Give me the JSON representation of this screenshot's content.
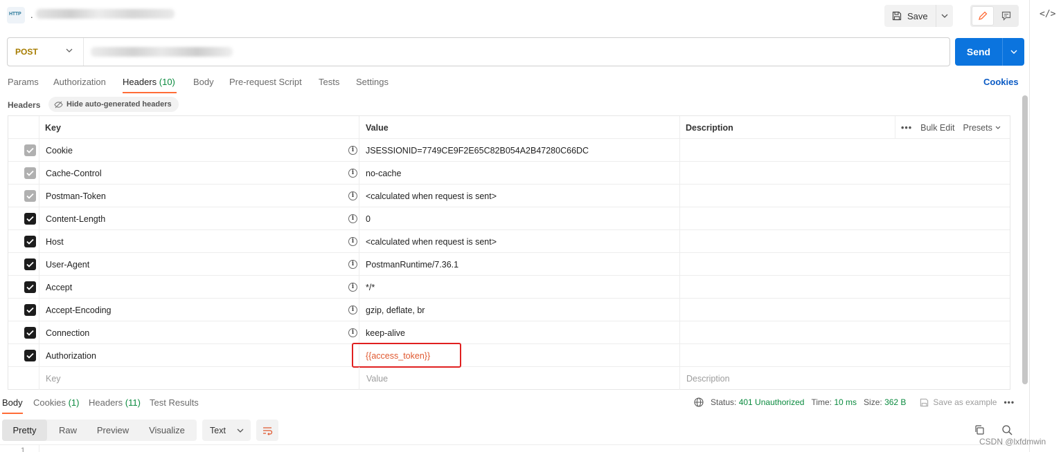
{
  "top": {
    "method_icon_label": "HTTP",
    "tab_prefix": ".",
    "save_label": "Save"
  },
  "url": {
    "method": "POST",
    "send_label": "Send"
  },
  "request_tabs": [
    {
      "label": "Params",
      "count": ""
    },
    {
      "label": "Authorization",
      "count": ""
    },
    {
      "label": "Headers",
      "count": "(10)"
    },
    {
      "label": "Body",
      "count": ""
    },
    {
      "label": "Pre-request Script",
      "count": ""
    },
    {
      "label": "Tests",
      "count": ""
    },
    {
      "label": "Settings",
      "count": ""
    }
  ],
  "cookies_label": "Cookies",
  "headers_section": {
    "title": "Headers",
    "hide_auto_label": "Hide auto-generated headers"
  },
  "table": {
    "columns": {
      "key": "Key",
      "value": "Value",
      "description": "Description"
    },
    "bulk_edit": "Bulk Edit",
    "presets": "Presets",
    "rows": [
      {
        "key": "Cookie",
        "value": "JSESSIONID=7749CE9F2E65C82B054A2B47280C66DC",
        "enabled": "auto"
      },
      {
        "key": "Cache-Control",
        "value": "no-cache",
        "enabled": "auto"
      },
      {
        "key": "Postman-Token",
        "value": "<calculated when request is sent>",
        "enabled": "auto"
      },
      {
        "key": "Content-Length",
        "value": "0",
        "enabled": "on"
      },
      {
        "key": "Host",
        "value": "<calculated when request is sent>",
        "enabled": "on"
      },
      {
        "key": "User-Agent",
        "value": "PostmanRuntime/7.36.1",
        "enabled": "on"
      },
      {
        "key": "Accept",
        "value": "*/*",
        "enabled": "on"
      },
      {
        "key": "Accept-Encoding",
        "value": "gzip, deflate, br",
        "enabled": "on"
      },
      {
        "key": "Connection",
        "value": "keep-alive",
        "enabled": "on"
      },
      {
        "key": "Authorization",
        "value": "{{access_token}}",
        "enabled": "on"
      }
    ],
    "new_row": {
      "key": "Key",
      "value": "Value",
      "description": "Description"
    }
  },
  "response": {
    "tabs": [
      {
        "label": "Body",
        "count": ""
      },
      {
        "label": "Cookies",
        "count": "(1)"
      },
      {
        "label": "Headers",
        "count": "(11)"
      },
      {
        "label": "Test Results",
        "count": ""
      }
    ],
    "status_label": "Status:",
    "status_value": "401 Unauthorized",
    "time_label": "Time:",
    "time_value": "10 ms",
    "size_label": "Size:",
    "size_value": "362 B",
    "save_example": "Save as example",
    "view_modes": [
      "Pretty",
      "Raw",
      "Preview",
      "Visualize"
    ],
    "format": "Text",
    "first_line_number": "1"
  },
  "watermark": "CSDN @lxfdmwin",
  "colors": {
    "accent": "#ff6c37",
    "send_blue": "#0b74de",
    "method_post": "#a67c00",
    "status_green": "#0a8a3e",
    "highlight_red": "#e02020"
  }
}
